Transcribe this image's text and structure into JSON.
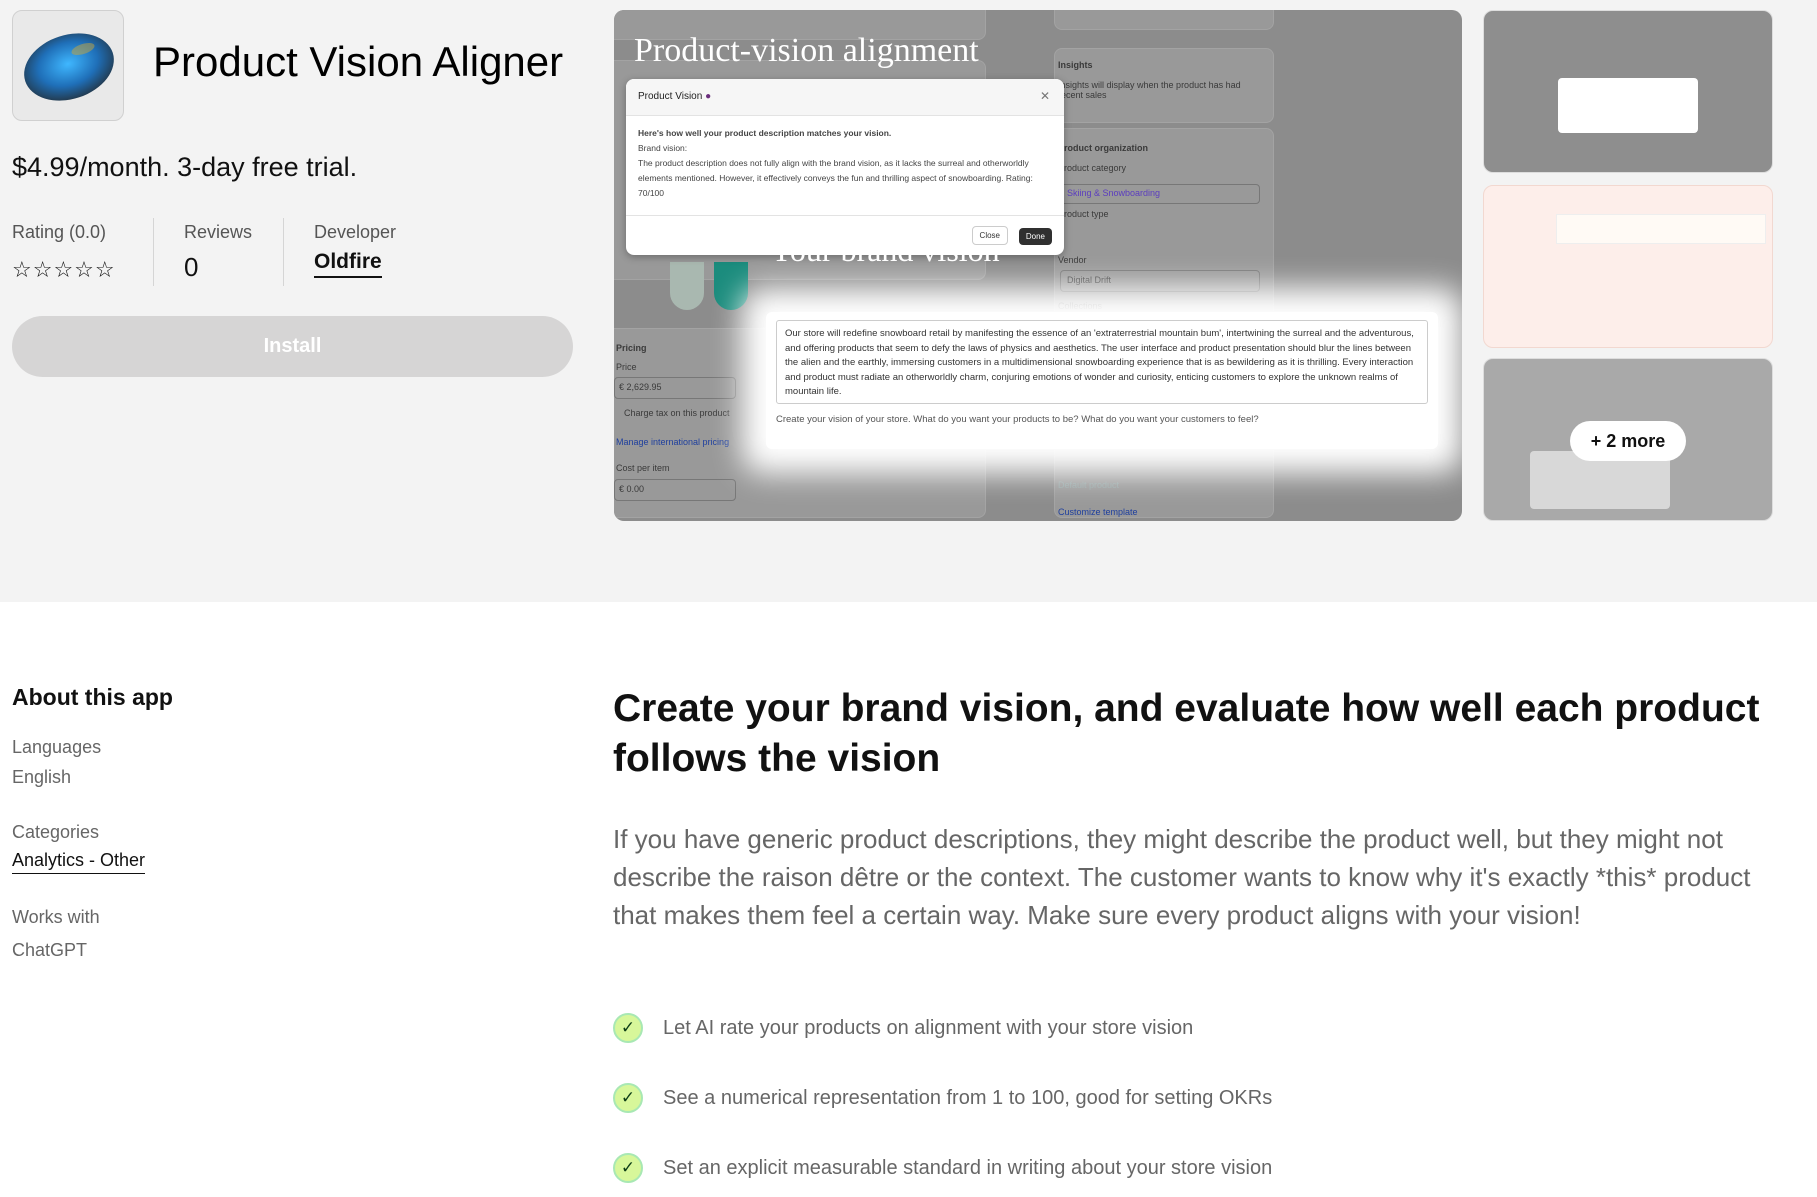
{
  "app": {
    "name": "Product Vision Aligner",
    "icon": "labradorite-stone-icon",
    "price": "$4.99/month. 3-day free trial.",
    "rating_label": "Rating (0.0)",
    "rating_value": 0,
    "stars": "☆☆☆☆☆",
    "reviews_label": "Reviews",
    "reviews_value": "0",
    "developer_label": "Developer",
    "developer": "Oldfire",
    "install_label": "Install"
  },
  "screenshot": {
    "title1": "Product-vision alignment",
    "title2": "Your brand vision",
    "dialog": {
      "title": "Product Vision",
      "intro": "Here's how well your product description matches your vision.",
      "brand_label": "Brand vision:",
      "result": "The product description does not fully align with the brand vision, as it lacks the surreal and otherworldly elements mentioned. However, it effectively conveys the fun and thrilling aspect of snowboarding. Rating: 70/100",
      "close": "Close",
      "done": "Done"
    },
    "vision_text": "Our store will redefine snowboard retail by manifesting the essence of an 'extraterrestrial mountain bum', intertwining the surreal and the adventurous, and offering products that seem to defy the laws of physics and aesthetics. The user interface and product presentation should blur the lines between the alien and the earthly, immersing customers in a multidimensional snowboarding experience that is as bewildering as it is thrilling. Every interaction and product must radiate an otherworldly charm, conjuring emotions of wonder and curiosity, enticing customers to explore the unknown realms of mountain life.",
    "vision_help": "Create your vision of your store. What do you want your products to be? What do you want your customers to feel?",
    "bg": {
      "insights": "Insights",
      "insights_text": "Insights will display when the product has had recent sales",
      "org": "Product organization",
      "category_label": "Product category",
      "category": "Skiing & Snowboarding",
      "type_label": "Product type",
      "vendor_label": "Vendor",
      "vendor": "Digital Drift",
      "collections": "Collections",
      "pricing": "Pricing",
      "price_label": "Price",
      "price": "€ 2,629.95",
      "tax": "Charge tax on this product",
      "intl": "Manage international pricing",
      "cost_label": "Cost per item",
      "cost": "€ 0.00",
      "customize": "Customize template",
      "default_product": "Default product"
    }
  },
  "thumbs": {
    "more": "+ 2 more"
  },
  "about": {
    "heading": "About this app",
    "languages_label": "Languages",
    "languages": "English",
    "categories_label": "Categories",
    "category": "Analytics - Other",
    "works_label": "Works with",
    "works": "ChatGPT"
  },
  "main": {
    "headline": "Create your brand vision, and evaluate how well each product follows the vision",
    "description": "If you have generic product descriptions, they might describe the product well, but they might not describe the raison dêtre or the context. The customer wants to know why it's exactly *this* product that makes them feel a certain way. Make sure every product aligns with your vision!",
    "features": [
      "Let AI rate your products on alignment with your store vision",
      "See a numerical representation from 1 to 100, good for setting OKRs",
      "Set an explicit measurable standard in writing about your store vision"
    ]
  },
  "colors": {
    "install_bg": "#d6d5d5",
    "check_bg": "#d7f79a",
    "top_bg": "#f3f3f3"
  }
}
